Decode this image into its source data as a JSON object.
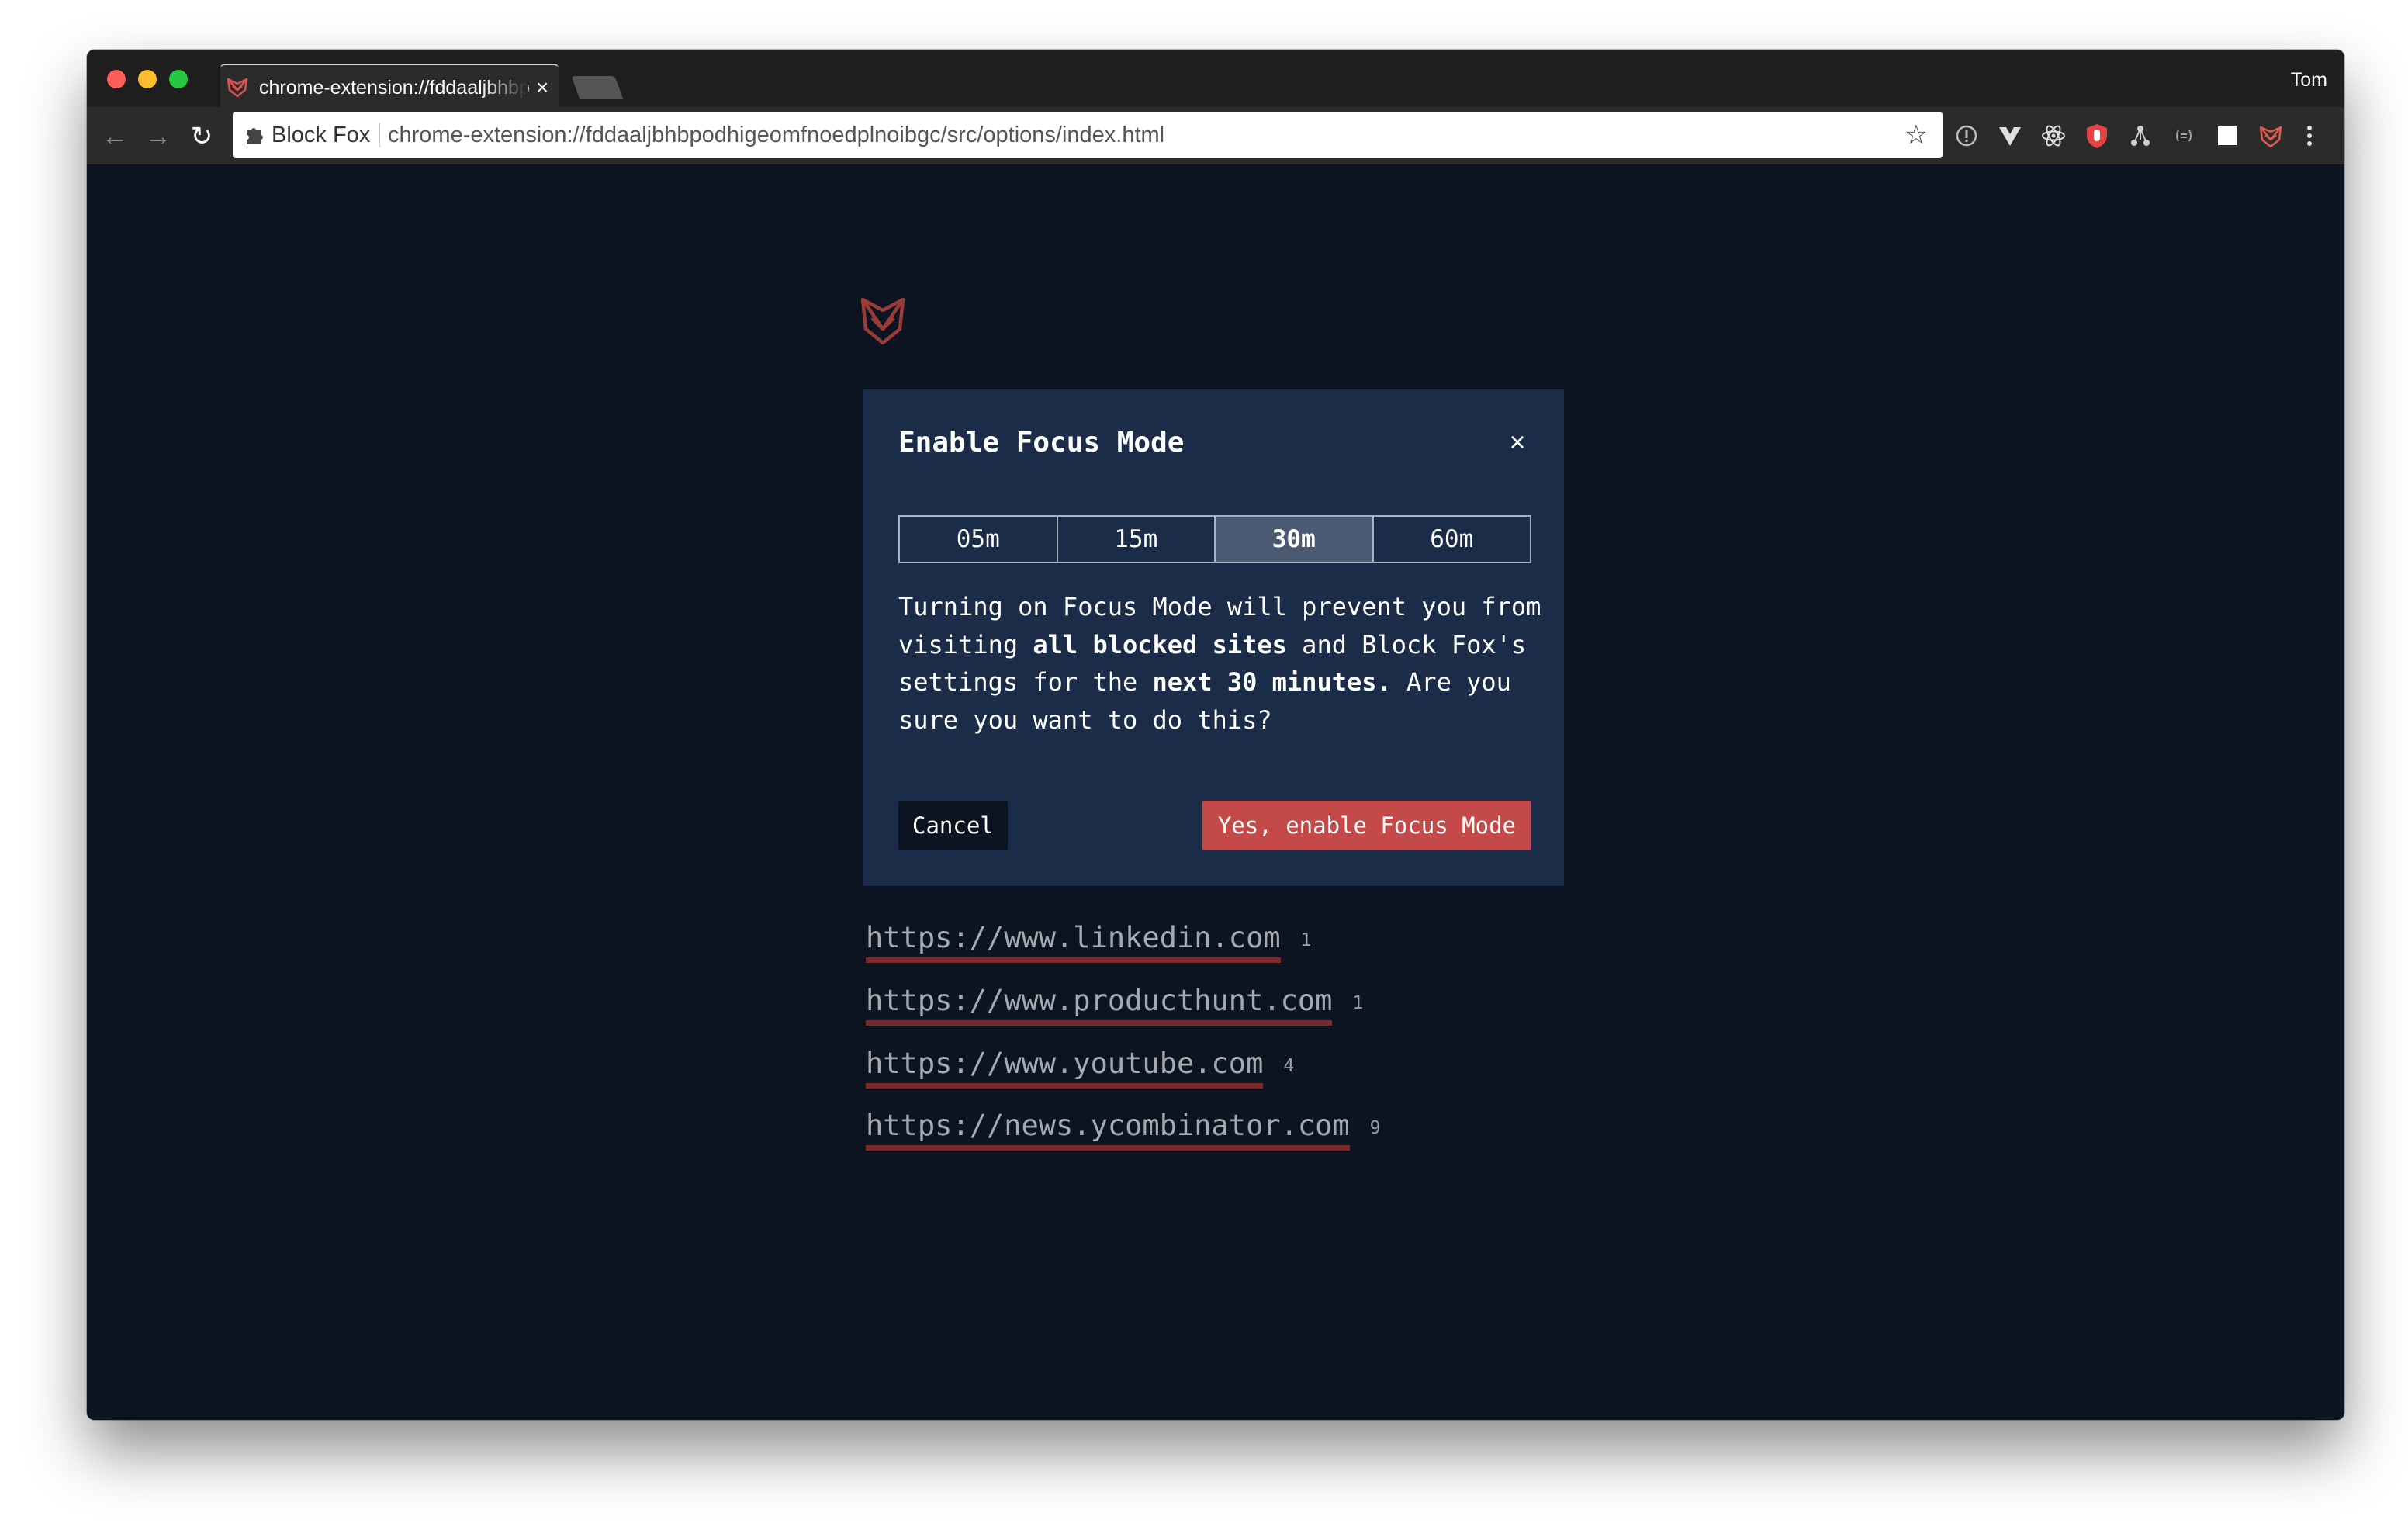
{
  "browser": {
    "tab_title": "chrome-extension://fddaaljbhbpodhigeomfnoedplnoibgc/src/options/index.html",
    "tab_close": "×",
    "profile_name": "Tom",
    "nav": {
      "back": "←",
      "forward": "→",
      "reload": "↻"
    },
    "omnibox": {
      "site_name": "Block Fox",
      "url": "chrome-extension://fddaaljbhbpodhigeomfnoedplnoibgc/src/options/index.html",
      "star": "☆"
    },
    "extension_icons": [
      "info-icon",
      "vue-icon",
      "react-icon",
      "ublock-icon",
      "graph-icon",
      "code-icon",
      "square-icon",
      "block-fox-icon",
      "menu-dots-icon"
    ]
  },
  "modal": {
    "title": "Enable Focus Mode",
    "close": "×",
    "durations": [
      "05m",
      "15m",
      "30m",
      "60m"
    ],
    "selected_duration": "30m",
    "message": {
      "part1": "Turning on Focus Mode will prevent you from visiting ",
      "bold1": "all blocked sites",
      "part2": " and Block Fox's settings for the ",
      "bold2": "next 30 minutes.",
      "part3": " Are you sure you want to do this?"
    },
    "cancel_label": "Cancel",
    "confirm_label": "Yes, enable Focus Mode"
  },
  "blocked_sites": [
    {
      "url": "https://www.linkedin.com",
      "count": "1"
    },
    {
      "url": "https://www.producthunt.com",
      "count": "1"
    },
    {
      "url": "https://www.youtube.com",
      "count": "4"
    },
    {
      "url": "https://news.ycombinator.com",
      "count": "9"
    }
  ],
  "colors": {
    "page_bg": "#0d1421",
    "modal_bg": "#1a2c47",
    "accent_red": "#c34a48",
    "link_underline": "#7b2a2c"
  }
}
